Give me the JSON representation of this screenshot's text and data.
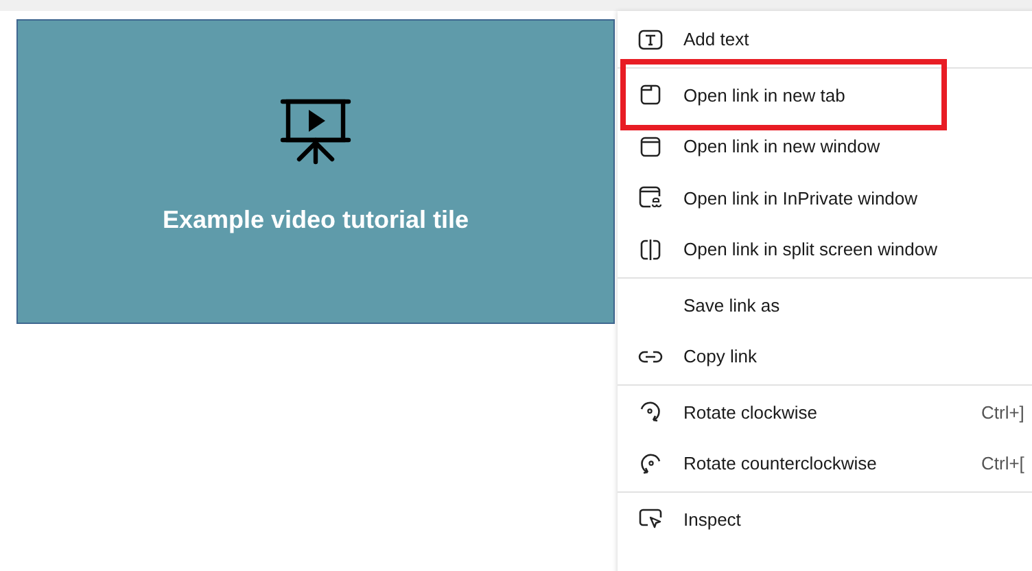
{
  "tile": {
    "title": "Example video tutorial tile"
  },
  "context_menu": {
    "groups": [
      {
        "items": [
          {
            "label": "Add text",
            "highlighted": false
          }
        ]
      },
      {
        "items": [
          {
            "label": "Open link in new tab",
            "highlighted": true
          },
          {
            "label": "Open link in new window",
            "highlighted": false
          },
          {
            "label": "Open link in InPrivate window",
            "highlighted": false
          },
          {
            "label": "Open link in split screen window",
            "highlighted": false
          }
        ]
      },
      {
        "items": [
          {
            "label": "Save link as",
            "highlighted": false
          },
          {
            "label": "Copy link",
            "highlighted": false
          }
        ]
      },
      {
        "items": [
          {
            "label": "Rotate clockwise",
            "shortcut": "Ctrl+]",
            "highlighted": false
          },
          {
            "label": "Rotate counterclockwise",
            "shortcut": "Ctrl+[",
            "highlighted": false
          }
        ]
      },
      {
        "items": [
          {
            "label": "Inspect",
            "highlighted": false
          }
        ]
      }
    ]
  }
}
